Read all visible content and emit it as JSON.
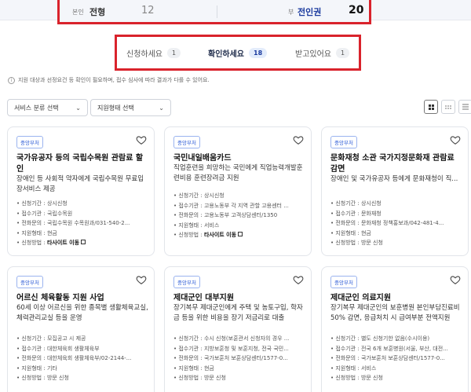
{
  "summary": {
    "left_label": "본인",
    "left_strong": "전형",
    "left_count": "12",
    "right_label": "부",
    "right_strong": "전인권",
    "right_count": "20"
  },
  "tabs": [
    {
      "label": "신청하세요",
      "count": "1",
      "active": false
    },
    {
      "label": "확인하세요",
      "count": "18",
      "active": true
    },
    {
      "label": "받고있어요",
      "count": "1",
      "active": false
    }
  ],
  "notice": "지원 대상과 선정요건 등 확인이 필요하며, 접수 심사에 따라 결과가 다를 수 있어요.",
  "filters": {
    "service_category": "서비스 분류 선택",
    "support_type": "지원형태 선택"
  },
  "detail_keys": {
    "period": "신청기간",
    "office": "접수기관",
    "contact": "전화문의",
    "type": "지원형태",
    "method": "신청방법"
  },
  "cards": [
    {
      "tag": "중앙부처",
      "title": "국가유공자 등의 국립수목원 관람료 할인",
      "desc": "장애인 등 사회적 약자에게 국립수목원 무료입장서비스 제공",
      "period": "상시신청",
      "office": "국립수목원",
      "contact": "국립수목원 수목원과/031-540-2...",
      "type": "현금",
      "method": "타사이트 이동"
    },
    {
      "tag": "중앙부처",
      "title": "국민내일배움카드",
      "desc": "직업훈련을 희망하는 국민에게 직업능력개발훈련비용 훈련장려금 지원",
      "period": "상시신청",
      "office": "고용노동부 각 지역 관할 고용센터 ...",
      "contact": "고용노동부 고객상담센터/1350",
      "type": "서비스",
      "method": "타사이트 이동"
    },
    {
      "tag": "중앙부처",
      "title": "문화재청 소관 국가지정문화재 관람료 감면",
      "desc": "장애인 및 국가유공자 등에게 문화재청이 직...",
      "period": "상시신청",
      "office": "문화재청",
      "contact": "문화재청 정책홍보과/042-481-4...",
      "type": "현금",
      "method": "방문 신청"
    },
    {
      "tag": "중앙부처",
      "title": "어르신 체육활동 지원 사업",
      "desc": "60세 이상 어르신을 위한 종목별 생활체육교실, 체력관리교실 등을 운영",
      "period": "모집공고 시 제공",
      "office": "대한체육회 생활체육부",
      "contact": "대한체육회 생활체육부/02-2144-...",
      "type": "기타",
      "method": "방문 신청"
    },
    {
      "tag": "중앙부처",
      "title": "제대군인 대부지원",
      "desc": "장기복무 제대군인에게 주택 및 농토구입, 학자금 등을 위한 비용을 장기 저금리로 대출",
      "period": "수시 신청(보훈관서 신청자의 경우 ...",
      "office": "지방보훈청 및 보훈지청, 전국 국민...",
      "contact": "국가보훈처 보훈상담센터/1577-0...",
      "type": "현금",
      "method": "방문 신청"
    },
    {
      "tag": "중앙부처",
      "title": "제대군인 의료지원",
      "desc": "장기복무 제대군인의 보훈병원 본인부담진료비 50% 감면, 응급처치 시 급여부분 전액지원",
      "period": "별도 신청기한 없음(수시이용)",
      "office": "전국 6개 보훈병원(서울, 부산, 대전...",
      "contact": "국가보훈처 보훈상담센터/1577-0...",
      "type": "서비스",
      "method": "방문 신청"
    }
  ]
}
